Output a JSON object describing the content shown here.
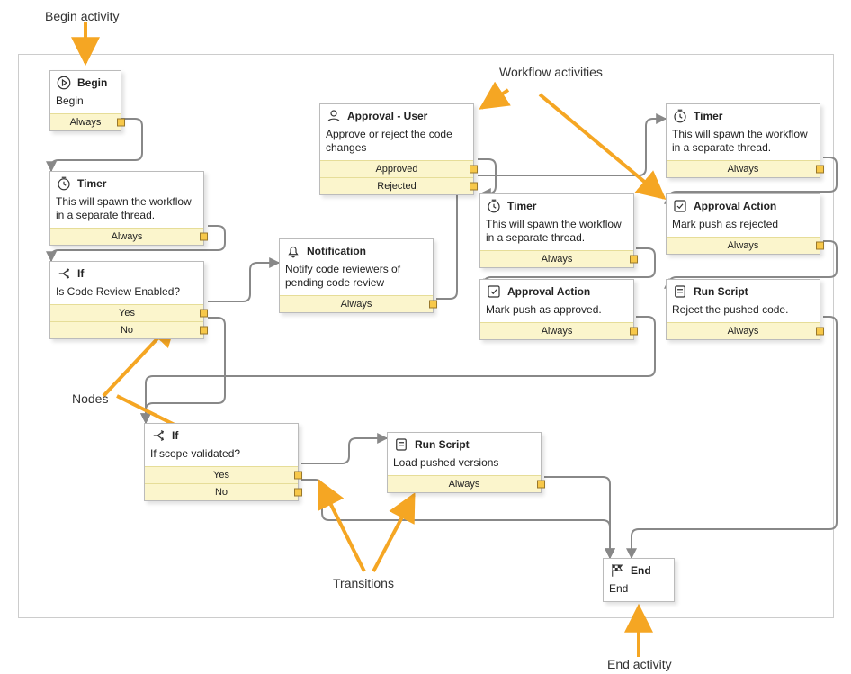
{
  "annotations": {
    "beginActivity": "Begin activity",
    "workflowActivities": "Workflow activities",
    "nodes": "Nodes",
    "transitions": "Transitions",
    "endActivity": "End activity"
  },
  "activities": {
    "begin": {
      "title": "Begin",
      "desc": "Begin",
      "outcomes": [
        "Always"
      ]
    },
    "timer1": {
      "title": "Timer",
      "desc": "This will spawn the workflow in a separate thread.",
      "outcomes": [
        "Always"
      ]
    },
    "if1": {
      "title": "If",
      "desc": "Is Code Review Enabled?",
      "outcomes": [
        "Yes",
        "No"
      ]
    },
    "notif": {
      "title": "Notification",
      "desc": "Notify code reviewers of pending code review",
      "outcomes": [
        "Always"
      ]
    },
    "apprUser": {
      "title": "Approval - User",
      "desc": "Approve or reject the code changes",
      "outcomes": [
        "Approved",
        "Rejected"
      ]
    },
    "timer2": {
      "title": "Timer",
      "desc": "This will spawn the workflow in a separate thread.",
      "outcomes": [
        "Always"
      ]
    },
    "apprAct1": {
      "title": "Approval Action",
      "desc": "Mark push as approved.",
      "outcomes": [
        "Always"
      ]
    },
    "timer3": {
      "title": "Timer",
      "desc": "This will spawn the workflow in a separate thread.",
      "outcomes": [
        "Always"
      ]
    },
    "apprAct2": {
      "title": "Approval Action",
      "desc": "Mark push as rejected",
      "outcomes": [
        "Always"
      ]
    },
    "runScr1": {
      "title": "Run Script",
      "desc": "Reject the pushed code.",
      "outcomes": [
        "Always"
      ]
    },
    "if2": {
      "title": "If",
      "desc": "If scope validated?",
      "outcomes": [
        "Yes",
        "No"
      ]
    },
    "runScr2": {
      "title": "Run Script",
      "desc": "Load pushed versions",
      "outcomes": [
        "Always"
      ]
    },
    "end": {
      "title": "End",
      "desc": "End",
      "outcomes": []
    }
  },
  "icons": {
    "begin": "play-circle-icon",
    "timer": "clock-icon",
    "if": "branch-icon",
    "notif": "bell-icon",
    "apprUser": "user-icon",
    "apprAct": "checkbox-icon",
    "runScr": "script-icon",
    "end": "flag-checkered-icon"
  }
}
